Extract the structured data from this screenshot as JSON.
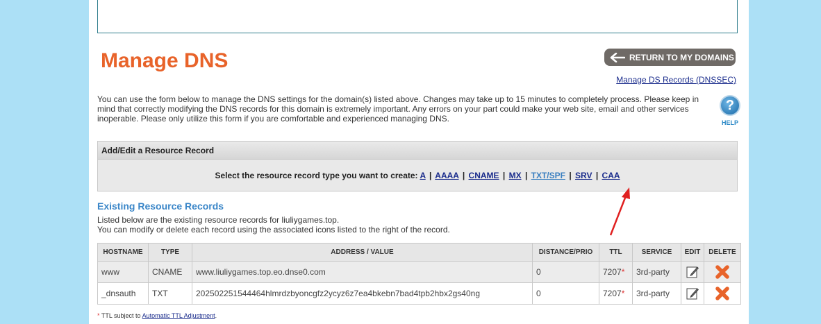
{
  "header": {
    "title": "Manage DNS",
    "return_label": "RETURN TO MY DOMAINS",
    "dnssec_link": "Manage DS Records (DNSSEC)"
  },
  "intro": {
    "text": "You can use the form below to manage the DNS settings for the domain(s) listed above. Changes may take up to 15 minutes to completely process. Please keep in mind that correctly modifying the DNS records for this domain is extremely important. Any errors on your part could make your web site, email and other services inoperable. Please only utilize this form if you are comfortable and experienced managing DNS."
  },
  "help": {
    "label": "HELP",
    "glyph": "?"
  },
  "resource_record": {
    "heading": "Add/Edit a Resource Record",
    "prompt": "Select the resource record type you want to create:",
    "types": [
      "A",
      "AAAA",
      "CNAME",
      "MX",
      "TXT/SPF",
      "SRV",
      "CAA"
    ],
    "separator": "|"
  },
  "existing": {
    "title": "Existing Resource Records",
    "line1": "Listed below are the existing resource records for liuliygames.top.",
    "line2": "You can modify or delete each record using the associated icons listed to the right of the record."
  },
  "table": {
    "headers": [
      "HOSTNAME",
      "TYPE",
      "ADDRESS / VALUE",
      "DISTANCE/PRIO",
      "TTL",
      "SERVICE",
      "EDIT",
      "DELETE"
    ],
    "rows": [
      {
        "hostname": "www",
        "type": "CNAME",
        "value": "www.liuliygames.top.eo.dnse0.com",
        "distance": "0",
        "ttl": "7207",
        "ttl_mark": "*",
        "service": "3rd-party"
      },
      {
        "hostname": "_dnsauth",
        "type": "TXT",
        "value": "202502251544464hlmrdzbyoncgfz2ycyz6z7ea4bkebn7bad4tpb2hbx2gs40ng",
        "distance": "0",
        "ttl": "7207",
        "ttl_mark": "*",
        "service": "3rd-party"
      }
    ]
  },
  "footnote": {
    "asterisk": "*",
    "text": "TTL subject to",
    "link": "Automatic TTL Adjustment",
    "end": "."
  },
  "colors": {
    "title": "#e8632a",
    "link": "#1a2c8c",
    "section_title": "#3a86c8",
    "delete": "#e8632a",
    "annotation": "#e02020"
  },
  "icons": [
    "arrow-left-icon",
    "help-icon",
    "edit-icon",
    "delete-icon",
    "annotation-arrow-icon"
  ]
}
